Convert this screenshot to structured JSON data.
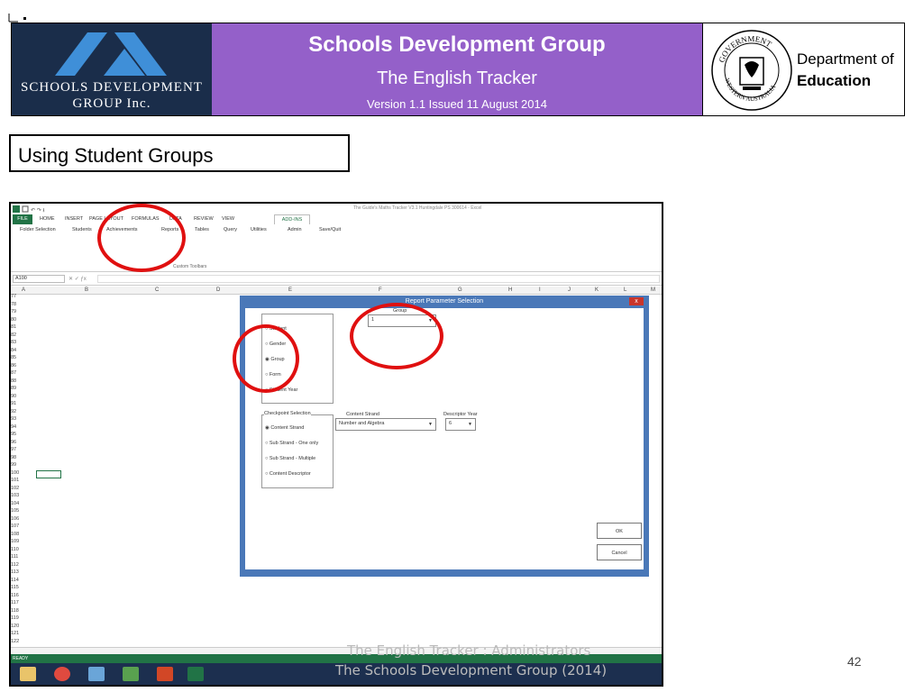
{
  "header": {
    "logo_text_line1": "SCHOOLS DEVELOPMENT",
    "logo_text_line2": "GROUP Inc.",
    "title": "Schools Development Group",
    "subtitle": "The English Tracker",
    "version": "Version 1.1 Issued 11 August 2014",
    "dept_line1": "Department of",
    "dept_line2": "Education",
    "seal_top": "GOVERNMENT",
    "seal_bottom": "WESTERN AUSTRALIA",
    "logo_color": "#1a2d4a",
    "title_color": "#9460c9"
  },
  "section_title": "Using Student Groups",
  "excel": {
    "window_title": "The Guide's Maths Tracker V3.1 Huntingdale PS 300614 - Excel",
    "tabs": [
      "FILE",
      "HOME",
      "INSERT",
      "PAGE LAYOUT",
      "FORMULAS",
      "DATA",
      "REVIEW",
      "VIEW",
      "ADD-INS"
    ],
    "ribbon_buttons": [
      "Folder Selection",
      "Students",
      "Achievements",
      "Reports",
      "Tables",
      "Query",
      "Utilities",
      "Admin",
      "Save/Quit"
    ],
    "custom_toolbars": "Custom Toolbars",
    "name_box": "A100",
    "columns": [
      "A",
      "B",
      "C",
      "D",
      "E",
      "F",
      "G",
      "H",
      "I",
      "J",
      "K",
      "L",
      "M"
    ],
    "rows": [
      "77",
      "78",
      "79",
      "80",
      "81",
      "82",
      "83",
      "84",
      "85",
      "86",
      "87",
      "88",
      "89",
      "90",
      "91",
      "92",
      "93",
      "94",
      "95",
      "96",
      "97",
      "98",
      "99",
      "100",
      "101",
      "102",
      "103",
      "104",
      "105",
      "106",
      "107",
      "108",
      "109",
      "110",
      "111",
      "112",
      "113",
      "114",
      "115",
      "116",
      "117",
      "118",
      "119",
      "120",
      "121",
      "122"
    ],
    "status": "READY",
    "accent": "#217346"
  },
  "dialog": {
    "title": "Report Parameter Selection",
    "close": "x",
    "report_options": [
      "Student",
      "Gender",
      "Group",
      "Form",
      "Student Year"
    ],
    "selected_report": "Group",
    "group_label": "Group",
    "group_value": "1",
    "checkpoint_label": "Checkpoint Selection",
    "checkpoint_options": [
      "Content Strand",
      "Sub Strand - One only",
      "Sub Strand - Multiple",
      "Content Descriptor"
    ],
    "selected_checkpoint": "Content Strand",
    "content_strand_label": "Content Strand",
    "content_strand_value": "Number and Algebra",
    "descriptor_year_label": "Descriptor Year",
    "descriptor_year_value": "6",
    "ok": "OK",
    "cancel": "Cancel"
  },
  "footer": {
    "line1": "The English Tracker :   Administrators",
    "line2": "The Schools Development Group  (2014)",
    "page": "42"
  }
}
